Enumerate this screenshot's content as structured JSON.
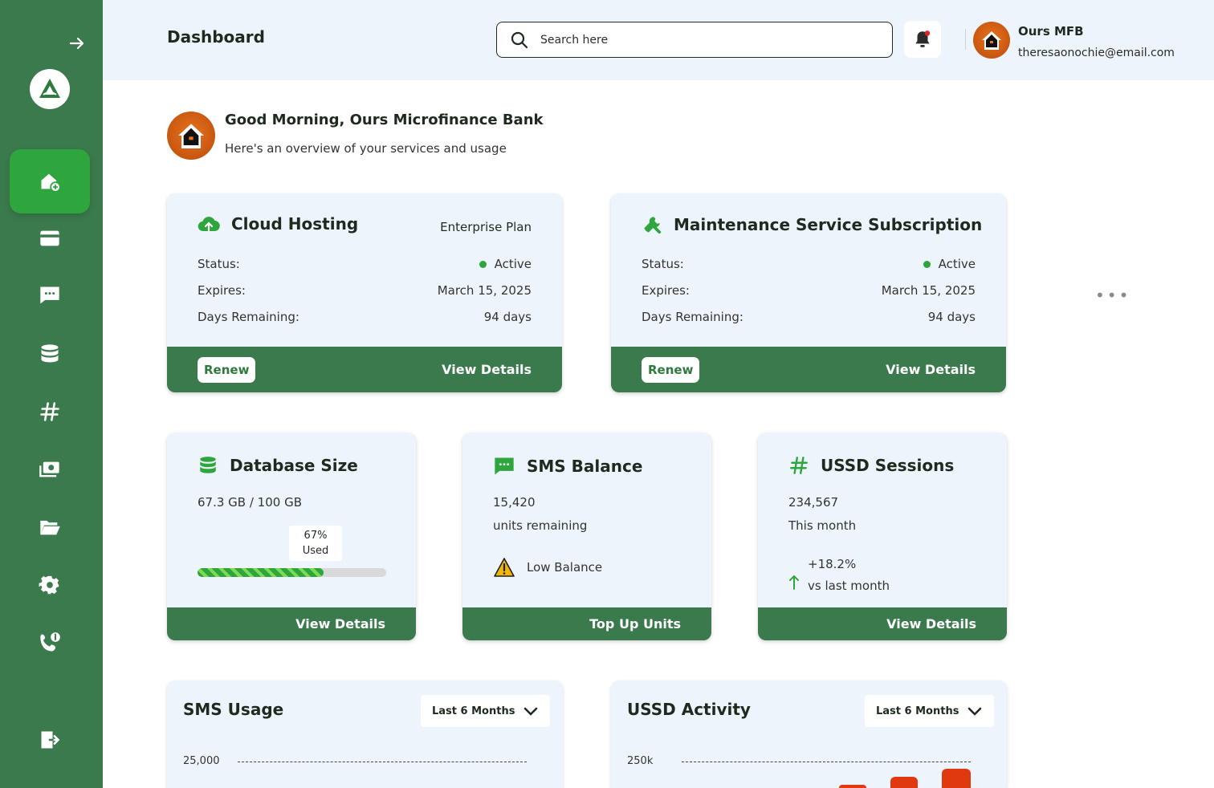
{
  "header": {
    "title": "Dashboard",
    "search_placeholder": "Search here",
    "user": {
      "name": "Ours MFB",
      "email": "theresaonochie@email.com"
    }
  },
  "sidebar": {
    "items": [
      {
        "icon": "home-icon",
        "active": true
      },
      {
        "icon": "credit-card-icon"
      },
      {
        "icon": "chat-icon"
      },
      {
        "icon": "database-icon"
      },
      {
        "icon": "hash-icon"
      },
      {
        "icon": "money-icon"
      },
      {
        "icon": "folder-icon"
      },
      {
        "icon": "gear-icon"
      },
      {
        "icon": "phone-info-icon"
      }
    ],
    "logout_icon": "logout-icon"
  },
  "greeting": {
    "title": "Good Morning, Ours Microfinance Bank",
    "subtitle": "Here's an overview of your services and usage"
  },
  "subscriptions": [
    {
      "title": "Cloud Hosting",
      "plan": "Enterprise Plan",
      "status_label": "Status:",
      "status": "Active",
      "expires_label": "Expires:",
      "expires": "March 15, 2025",
      "days_label": "Days Remaining:",
      "days": "94 days",
      "renew_label": "Renew",
      "details_label": "View Details"
    },
    {
      "title": "Maintenance Service Subscription",
      "plan": "",
      "status_label": "Status:",
      "status": "Active",
      "expires_label": "Expires:",
      "expires": "March 15, 2025",
      "days_label": "Days Remaining:",
      "days": "94 days",
      "renew_label": "Renew",
      "details_label": "View Details"
    }
  ],
  "metrics": {
    "database": {
      "title": "Database Size",
      "value": "67.3 GB / 100 GB",
      "pct_label": "67%",
      "used_label": "Used",
      "used_fraction": 0.67,
      "action": "View Details"
    },
    "sms": {
      "title": "SMS Balance",
      "value": "15,420",
      "caption": "units remaining",
      "warning": "Low Balance",
      "action": "Top Up Units"
    },
    "ussd": {
      "title": "USSD Sessions",
      "value": "234,567",
      "caption": "This month",
      "change": "+18.2%",
      "change_caption": "vs last month",
      "action": "View Details"
    }
  },
  "charts": [
    {
      "title": "SMS Usage",
      "range": "Last 6 Months",
      "tick": "25,000"
    },
    {
      "title": "USSD Activity",
      "range": "Last 6 Months",
      "tick": "250k"
    }
  ],
  "colors": {
    "sidebar": "#3b7a4c",
    "active": "#2ea63d",
    "bar": "#e0380f",
    "card": "#eef4fb"
  }
}
